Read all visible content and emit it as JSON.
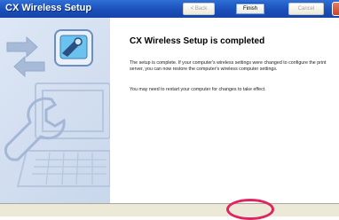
{
  "window": {
    "title": "CX Wireless Setup"
  },
  "content": {
    "heading": "CX Wireless Setup is completed",
    "paragraph1": "The setup is complete. If your computer's wireless settings were changed to configure the print server, you can now restore the computer's wireless computer settings.",
    "paragraph2": "You may need to restart your computer for changes to take effect."
  },
  "buttons": {
    "back_label": "< Back",
    "finish_label": "Finish",
    "cancel_label": "Cancel"
  },
  "colors": {
    "titlebar": "#1a4fba",
    "highlight_ring": "#e0245f",
    "panel": "#c9d7ec"
  }
}
